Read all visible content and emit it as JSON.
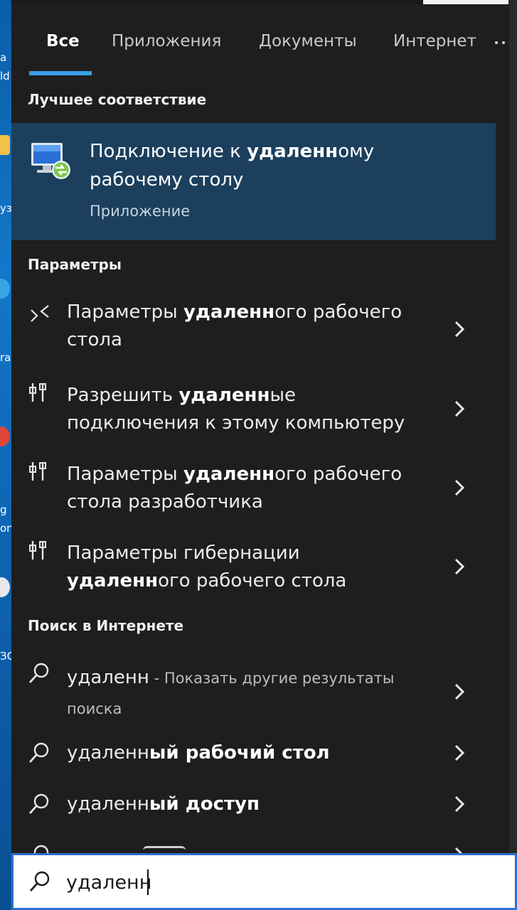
{
  "desktop": {
    "fragments": [
      "а",
      "ld",
      "уз",
      "ra",
      "g",
      "on",
      "ЗС"
    ]
  },
  "tabs": [
    {
      "label": "Все",
      "active": true
    },
    {
      "label": "Приложения",
      "active": false
    },
    {
      "label": "Документы",
      "active": false
    },
    {
      "label": "Интернет",
      "active": false
    }
  ],
  "best_match": {
    "section_title": "Лучшее соответствие",
    "title_1": "Подключение к ",
    "title_bold": "удаленн",
    "title_2": "ому",
    "title_line2": "рабочему столу",
    "type": "Приложение",
    "icon": "remote-desktop-icon"
  },
  "settings": {
    "section_title": "Параметры",
    "items": [
      {
        "icon": "remote-display-icon",
        "pre": "Параметры ",
        "bold": "удаленн",
        "post": "ого рабочего",
        "line2": "стола"
      },
      {
        "icon": "settings-sliders-icon",
        "pre": "Разрешить ",
        "bold": "удаленн",
        "post": "ые",
        "line2": "подключения к этому компьютеру"
      },
      {
        "icon": "settings-sliders-icon",
        "pre": "Параметры ",
        "bold": "удаленн",
        "post": "ого рабочего",
        "line2": "стола разработчика"
      },
      {
        "icon": "settings-sliders-icon",
        "pre": "Параметры гибернации",
        "bold": "",
        "post": "",
        "line2_bold": "удаленн",
        "line2": "ого рабочего стола"
      }
    ]
  },
  "web": {
    "section_title": "Поиск в Интернете",
    "items": [
      {
        "main": "удаленн",
        "suffix": " - Показать другие результаты",
        "line2": "поиска"
      },
      {
        "plain": "удаленн",
        "bold": "ый рабочий стол"
      },
      {
        "plain": "удаленн",
        "bold": "ый доступ"
      }
    ]
  },
  "search": {
    "value": "удаленн"
  },
  "colors": {
    "accent": "#3a9ee8",
    "selected_bg": "#1c3f5d",
    "panel_bg": "#1e1e1e"
  }
}
